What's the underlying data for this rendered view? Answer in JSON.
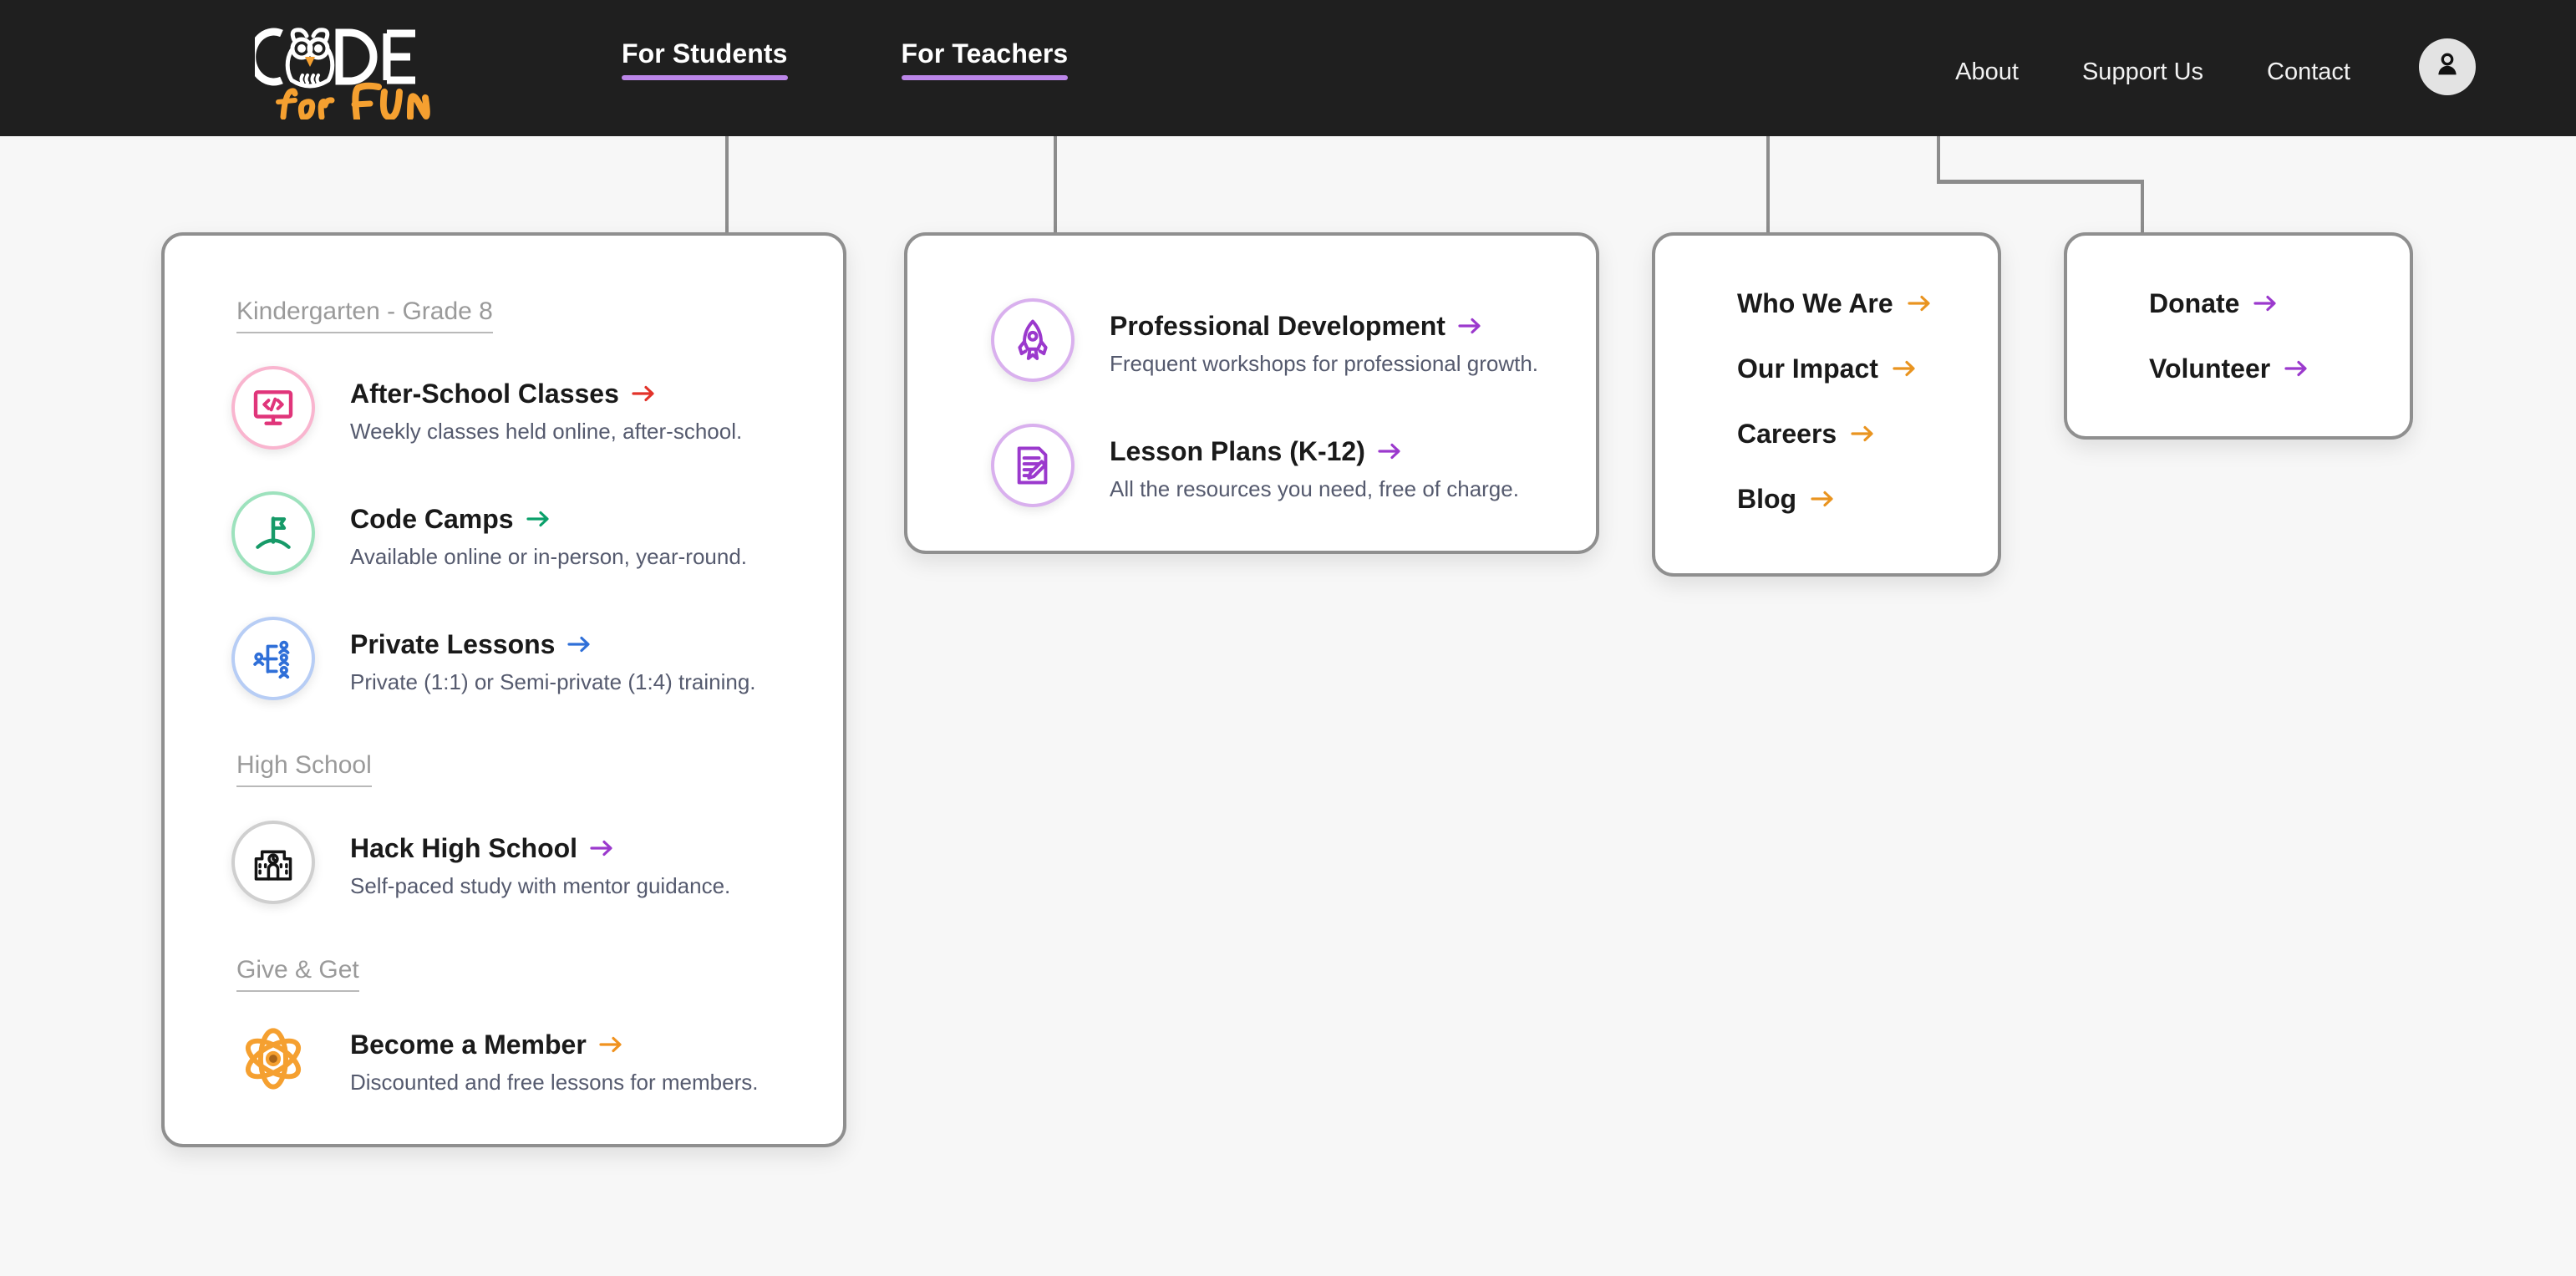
{
  "brand": {
    "name_top": "CODE",
    "name_bottom": "for FUN",
    "logo_icon": "owl-logo-icon",
    "accent": "#f5a030"
  },
  "header": {
    "background": "#1f1f1f",
    "active_underline_color": "#bb86e8",
    "tabs": [
      {
        "label": "For Students",
        "active": true
      },
      {
        "label": "For Teachers",
        "active": true
      }
    ],
    "links": [
      {
        "label": "About"
      },
      {
        "label": "Support Us"
      },
      {
        "label": "Contact"
      }
    ],
    "account": {
      "icon": "user-account-icon",
      "label": "Account"
    }
  },
  "students_menu": {
    "sections": [
      {
        "heading": "Kindergarten - Grade 8",
        "items": [
          {
            "title": "After-School Classes",
            "desc": "Weekly classes held online, after-school.",
            "icon": "code-monitor-icon",
            "color": "#e0357a",
            "ring": "#f9b5cf",
            "arrow_color": "#e2332a"
          },
          {
            "title": "Code Camps",
            "desc": "Available online or in-person, year-round.",
            "icon": "flag-hill-icon",
            "color": "#169a68",
            "ring": "#9de2bd",
            "arrow_color": "#0aa06a"
          },
          {
            "title": "Private Lessons",
            "desc": "Private (1:1) or Semi-private (1:4) training.",
            "icon": "people-network-icon",
            "color": "#2f6fd8",
            "ring": "#b7cdf5",
            "arrow_color": "#2f6fd8"
          }
        ]
      },
      {
        "heading": "High School",
        "items": [
          {
            "title": "Hack High School",
            "desc": "Self-paced study with mentor guidance.",
            "icon": "school-building-icon",
            "color": "#141414",
            "ring": "#c9c9c9",
            "arrow_color": "#9b39cd"
          }
        ]
      },
      {
        "heading": "Give & Get",
        "items": [
          {
            "title": "Become a Member",
            "desc": "Discounted and free lessons for members.",
            "icon": "atom-icon",
            "color": "#f5a030",
            "ring": "none",
            "arrow_color": "#f0921f"
          }
        ]
      }
    ]
  },
  "teachers_menu": {
    "items": [
      {
        "title": "Professional Development",
        "desc": "Frequent workshops for professional growth.",
        "icon": "rocket-icon",
        "color": "#9b39cd",
        "ring": "#d9b0ee",
        "arrow_color": "#9b39cd"
      },
      {
        "title": "Lesson Plans (K-12)",
        "desc": "All the resources you need, free of charge.",
        "icon": "document-pencil-icon",
        "color": "#9b39cd",
        "ring": "#d9b0ee",
        "arrow_color": "#9b39cd"
      }
    ]
  },
  "about_menu": {
    "arrow_color": "#e99420",
    "items": [
      {
        "label": "Who We Are"
      },
      {
        "label": "Our Impact"
      },
      {
        "label": "Careers"
      },
      {
        "label": "Blog"
      }
    ]
  },
  "support_menu": {
    "arrow_color": "#9b39cd",
    "items": [
      {
        "label": "Donate"
      },
      {
        "label": "Volunteer"
      }
    ]
  }
}
